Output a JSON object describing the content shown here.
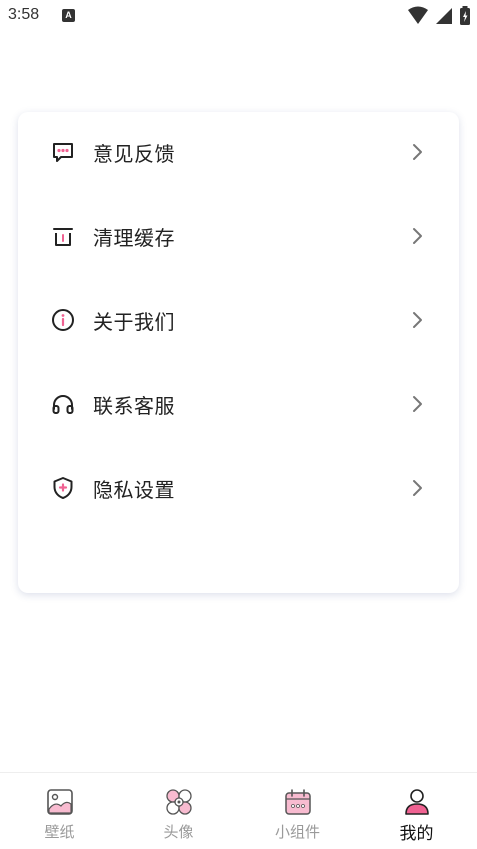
{
  "status_bar": {
    "time": "3:58",
    "notification_badge": "A"
  },
  "menu": {
    "items": [
      {
        "label": "意见反馈",
        "icon": "feedback-message-icon"
      },
      {
        "label": "清理缓存",
        "icon": "trash-icon"
      },
      {
        "label": "关于我们",
        "icon": "info-icon"
      },
      {
        "label": "联系客服",
        "icon": "headset-icon"
      },
      {
        "label": "隐私设置",
        "icon": "shield-icon"
      }
    ]
  },
  "tab_bar": {
    "tabs": [
      {
        "label": "壁纸",
        "icon": "wallpaper-icon",
        "active": false
      },
      {
        "label": "头像",
        "icon": "avatar-flower-icon",
        "active": false
      },
      {
        "label": "小组件",
        "icon": "widget-calendar-icon",
        "active": false
      },
      {
        "label": "我的",
        "icon": "profile-icon",
        "active": true
      }
    ]
  },
  "colors": {
    "accent_pink": "#f48fb1",
    "active_pink": "#f06292",
    "text_primary": "#222222",
    "text_inactive": "#9a9a9a"
  }
}
